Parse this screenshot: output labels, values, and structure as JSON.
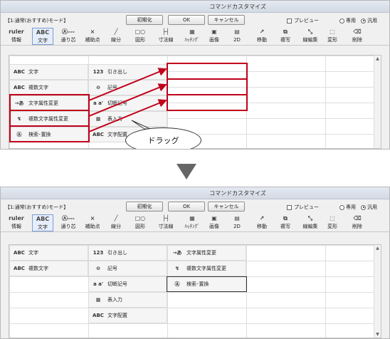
{
  "window_title": "コマンドカスタマイズ",
  "mode_label": "【1:通常(おすすめ)モード】",
  "buttons": {
    "init": "初期化",
    "ok": "OK",
    "cancel": "キャンセル"
  },
  "preview_label": "プレビュー",
  "radios": {
    "exclusive": "専用",
    "general": "汎用"
  },
  "toolbar": [
    {
      "icon": "ruler",
      "label": "情報"
    },
    {
      "icon": "ABC",
      "label": "文字"
    },
    {
      "icon": "Ⓐ---",
      "label": "通り芯"
    },
    {
      "icon": "×",
      "label": "補助点"
    },
    {
      "icon": "╱",
      "label": "線分"
    },
    {
      "icon": "□○",
      "label": "図形"
    },
    {
      "icon": "├┤",
      "label": "寸法線"
    },
    {
      "icon": "▦",
      "label": "ﾊｯﾁﾝｸﾞ"
    },
    {
      "icon": "▣",
      "label": "画像"
    },
    {
      "icon": "▤",
      "label": "2D"
    },
    {
      "icon": "↗",
      "label": "移動"
    },
    {
      "icon": "⧉",
      "label": "複写"
    },
    {
      "icon": "⤡",
      "label": "線編集"
    },
    {
      "icon": "⬚",
      "label": "変形"
    },
    {
      "icon": "⌫",
      "label": "削除"
    }
  ],
  "col1_items": [
    {
      "icon": "ABC",
      "label": "文字"
    },
    {
      "icon": "ABC",
      "label": "複数文字"
    },
    {
      "icon": "→あ",
      "label": "文字属性変更"
    },
    {
      "icon": "↯",
      "label": "複数文字属性変更"
    },
    {
      "icon": "Ⓐ",
      "label": "検索･置換"
    }
  ],
  "col2_items": [
    {
      "icon": "123",
      "label": "引き出し"
    },
    {
      "icon": "⊖",
      "label": "記号"
    },
    {
      "icon": "a a'",
      "label": "切断記号"
    },
    {
      "icon": "▦",
      "label": "表入力"
    },
    {
      "icon": "ABC",
      "label": "文字配置"
    }
  ],
  "col3_items": [
    {
      "icon": "→あ",
      "label": "文字属性変更"
    },
    {
      "icon": "↯",
      "label": "複数文字属性変更"
    },
    {
      "icon": "Ⓐ",
      "label": "検索･置換"
    }
  ],
  "drag_label": "ドラッグ",
  "colors": {
    "highlight": "#c0001a",
    "titlebar": "#d9e0ea",
    "arrow": "#666666"
  }
}
